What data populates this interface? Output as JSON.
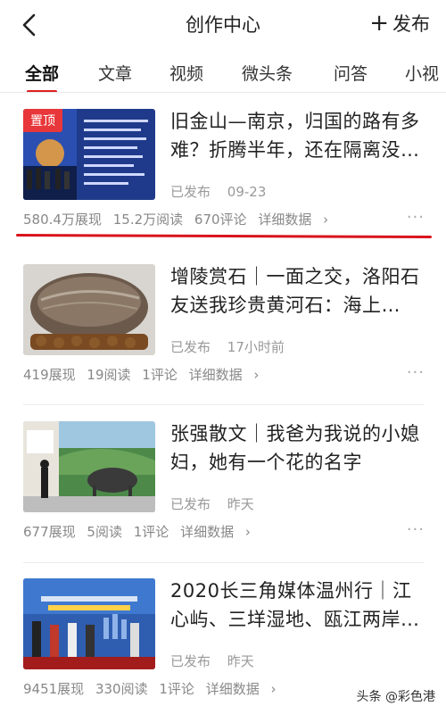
{
  "header": {
    "title": "创作中心",
    "publish_label": "发布"
  },
  "tabs": [
    "全部",
    "文章",
    "视频",
    "微头条",
    "问答",
    "小视"
  ],
  "articles": [
    {
      "pinned_label": "置顶",
      "title": "旧金山—南京，归国的路有多难？折腾半年，还在隔离没…",
      "status": "已发布",
      "time": "09-23",
      "impressions": "580.4万展现",
      "reads": "15.2万阅读",
      "comments": "670评论",
      "details": "详细数据",
      "more": "···"
    },
    {
      "title": "增陵赏石｜一面之交，洛阳石友送我珍贵黄河石：海上…",
      "status": "已发布",
      "time": "17小时前",
      "impressions": "419展现",
      "reads": "19阅读",
      "comments": "1评论",
      "details": "详细数据",
      "more": "···"
    },
    {
      "title": "张强散文｜我爸为我说的小媳妇，她有一个花的名字",
      "status": "已发布",
      "time": "昨天",
      "impressions": "677展现",
      "reads": "5阅读",
      "comments": "1评论",
      "details": "详细数据",
      "more": "···"
    },
    {
      "title": "2020长三角媒体温州行｜江心屿、三垟湿地、瓯江两岸…",
      "status": "已发布",
      "time": "昨天",
      "impressions": "9451展现",
      "reads": "330阅读",
      "comments": "1评论",
      "details": "详细数据",
      "more": "···"
    }
  ],
  "watermark": "头条 @彩色港",
  "colors": {
    "accent_red": "#e02020",
    "pin_badge": "#e8373a",
    "meta_gray": "#999999"
  }
}
